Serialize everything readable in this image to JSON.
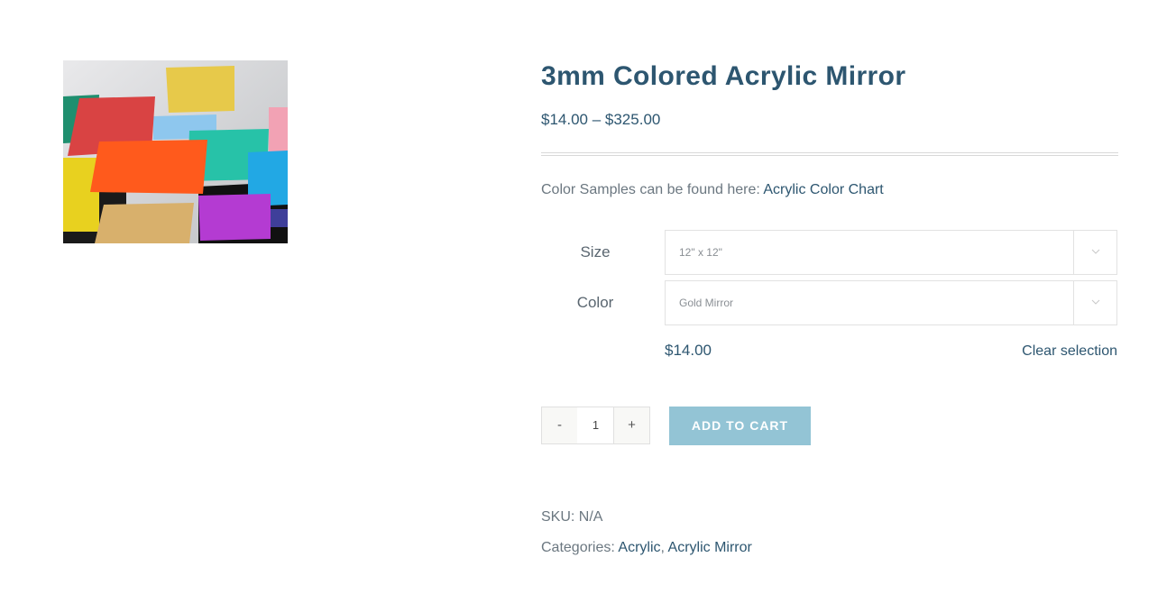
{
  "product": {
    "title": "3mm Colored Acrylic Mirror",
    "price_range": "$14.00 – $325.00",
    "image_alt": "Colored acrylic mirror squares"
  },
  "samples": {
    "text": "Color Samples can be found here: ",
    "link": "Acrylic Color Chart"
  },
  "variations": {
    "size": {
      "label": "Size",
      "value": "12\" x 12\""
    },
    "color": {
      "label": "Color",
      "value": "Gold Mirror"
    },
    "price": "$14.00",
    "clear_label": "Clear selection"
  },
  "quantity": {
    "minus": "-",
    "value": "1",
    "plus": "+"
  },
  "cart": {
    "button_label": "ADD TO CART"
  },
  "meta": {
    "sku_label": "SKU:",
    "sku_value": "N/A",
    "categories_label": "Categories:",
    "categories": [
      "Acrylic",
      "Acrylic Mirror"
    ],
    "separator": ","
  },
  "colors": {
    "title": "#2d5670",
    "button": "#93c4d5",
    "text": "#5a6b78"
  },
  "icons": {
    "select_arrow": "chevron-down-icon"
  }
}
